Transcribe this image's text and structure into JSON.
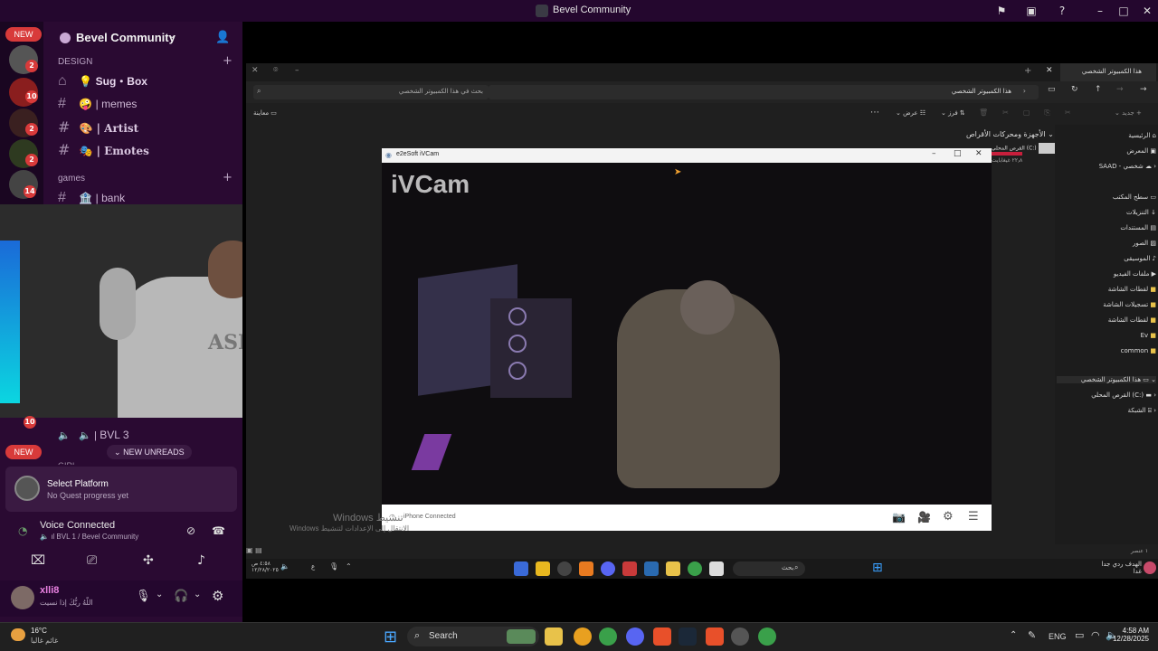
{
  "window": {
    "title": "Bevel Community"
  },
  "server": {
    "name": "Bevel Community",
    "new_top": "NEW",
    "new_bottom": "NEW",
    "badges": [
      "2",
      "10",
      "2",
      "2",
      "14",
      "10"
    ],
    "categories": {
      "design": "DESIGN",
      "games": "games"
    },
    "channels": [
      {
        "label": "Sug・Box",
        "emoji": "💡"
      },
      {
        "label": "| memes",
        "emoji": "🤪"
      },
      {
        "label": "| Artist",
        "emoji": "🎨"
      },
      {
        "label": "| Emotes",
        "emoji": "🎭"
      },
      {
        "label": "| bank",
        "emoji": "🏦"
      }
    ],
    "voice_channel": "BVL 3",
    "new_unreads": "NEW UNREADS",
    "partial_channel": "GIRL"
  },
  "quest": {
    "title": "Select Platform",
    "subtitle": "No Quest progress yet"
  },
  "voice": {
    "status": "Voice Connected",
    "channel": "BVL 1 / Bevel Community"
  },
  "user": {
    "name": "xlli8",
    "status": "اللّهُ ربُّكَ إذا نسيت"
  },
  "explorer": {
    "tab_title": "هذا الكمبيوتر الشخصي",
    "breadcrumb": "هذا الكمبيوتر الشخصي",
    "search_placeholder": "بحث في هذا الكمبيوتر الشخصي",
    "new_label": "جديد",
    "sort_label": "فرز",
    "view_label": "عرض",
    "preview_label": "معاينة",
    "section": "الأجهزة ومحركات الأقراص",
    "drive_label": "القرص المحلي (C:)",
    "drive_free": "٢٢٫٨ غيغابايت",
    "status_items": "١ عنصر",
    "sidebar": [
      "الرئيسية",
      "المعرض",
      "SAAD - شخصي",
      "سطح المكتب",
      "التنزيلات",
      "المستندات",
      "الصور",
      "الموسيقى",
      "ملفات الفيديو",
      "لقطات الشاشة",
      "تسجيلات الشاشة",
      "لقطات الشاشة",
      "Ev",
      "common",
      "هذا الكمبيوتر الشخصي",
      "القرص المحلي (C:)",
      "الشبكة"
    ]
  },
  "ivcam": {
    "title": "e2eSoft iVCam",
    "watermark": "iVCam",
    "status": "iPhone Connected"
  },
  "activation": {
    "line1": "Windows تنشيط",
    "line2": "Windows الانتقال إلى الإعدادات لتنشيط"
  },
  "inner_taskbar": {
    "time": "٤:٥٨ ص",
    "date": "١٢/٢٨/٢٠٢٥",
    "search": "بحث",
    "news": "الهدف ردي جدا",
    "news_sub": "غدا",
    "lang": "ع"
  },
  "taskbar": {
    "weather_temp": "16°C",
    "weather_text": "غائم غالبا",
    "search": "Search",
    "lang": "ENG",
    "time": "4:58 AM",
    "date": "12/28/2025"
  }
}
